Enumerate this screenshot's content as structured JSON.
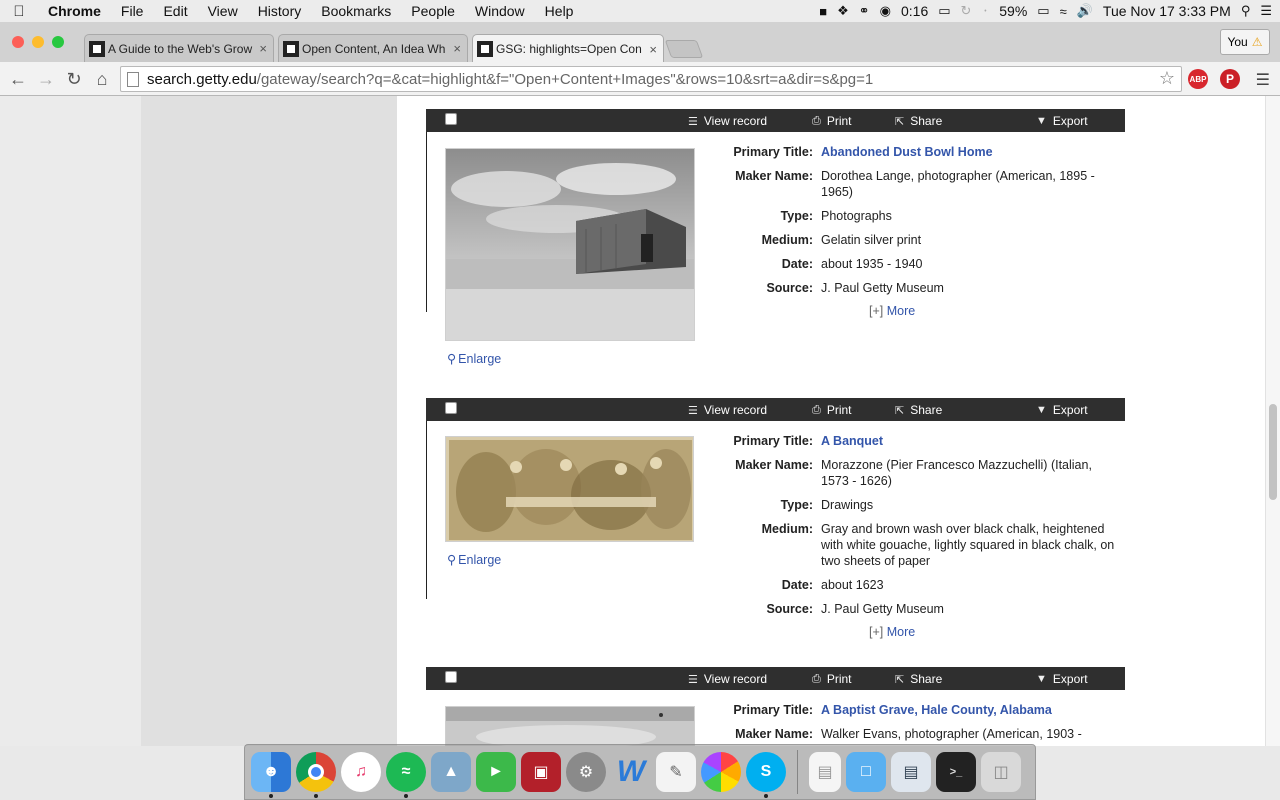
{
  "menubar": {
    "app": "Chrome",
    "items": [
      "File",
      "Edit",
      "View",
      "History",
      "Bookmarks",
      "People",
      "Window",
      "Help"
    ],
    "battery_timer": "0:16",
    "battery_percent": "59%",
    "clock": "Tue Nov 17  3:33 PM"
  },
  "tabs": [
    {
      "label": "A Guide to the Web's Grow",
      "close": "×"
    },
    {
      "label": "Open Content, An Idea Wh",
      "close": "×"
    },
    {
      "label": "GSG: highlights=Open Con",
      "close": "×"
    }
  ],
  "profile": {
    "label": "You"
  },
  "toolbar": {
    "url_host": "search.getty.edu",
    "url_path": "/gateway/search?q=&cat=highlight&f=\"Open+Content+Images\"&rows=10&srt=a&dir=s&pg=1"
  },
  "extensions": {
    "adblock": "ABP",
    "pinterest": "P"
  },
  "record_actions": {
    "view": "View record",
    "print": "Print",
    "share": "Share",
    "export": "Export"
  },
  "labels": {
    "primary_title": "Primary Title:",
    "maker": "Maker Name:",
    "type": "Type:",
    "medium": "Medium:",
    "date": "Date:",
    "source": "Source:",
    "enlarge": "Enlarge",
    "more_plus": "[+]",
    "more": "More"
  },
  "records": [
    {
      "title": "Abandoned Dust Bowl Home",
      "maker": "Dorothea Lange, photographer (American, 1895 - 1965)",
      "type": "Photographs",
      "medium": "Gelatin silver print",
      "date": "about 1935 - 1940",
      "source": "J. Paul Getty Museum"
    },
    {
      "title": "A Banquet",
      "maker": "Morazzone (Pier Francesco Mazzuchelli) (Italian, 1573 - 1626)",
      "type": "Drawings",
      "medium": "Gray and brown wash over black chalk, heightened with white gouache, lightly squared in black chalk, on two sheets of paper",
      "date": "about 1623",
      "source": "J. Paul Getty Museum"
    },
    {
      "title": "A Baptist Grave, Hale County, Alabama",
      "maker": "Walker Evans, photographer (American, 1903 -"
    }
  ],
  "dock": [
    "finder-icon",
    "chrome-icon",
    "itunes-icon",
    "spotify-icon",
    "preview-icon",
    "facetime-icon",
    "photo-booth-icon",
    "system-preferences-icon",
    "word-icon",
    "textedit-icon",
    "photos-icon",
    "skype-icon",
    "document-icon",
    "folder-icon",
    "screenshot-icon",
    "terminal-icon",
    "trash-icon"
  ]
}
